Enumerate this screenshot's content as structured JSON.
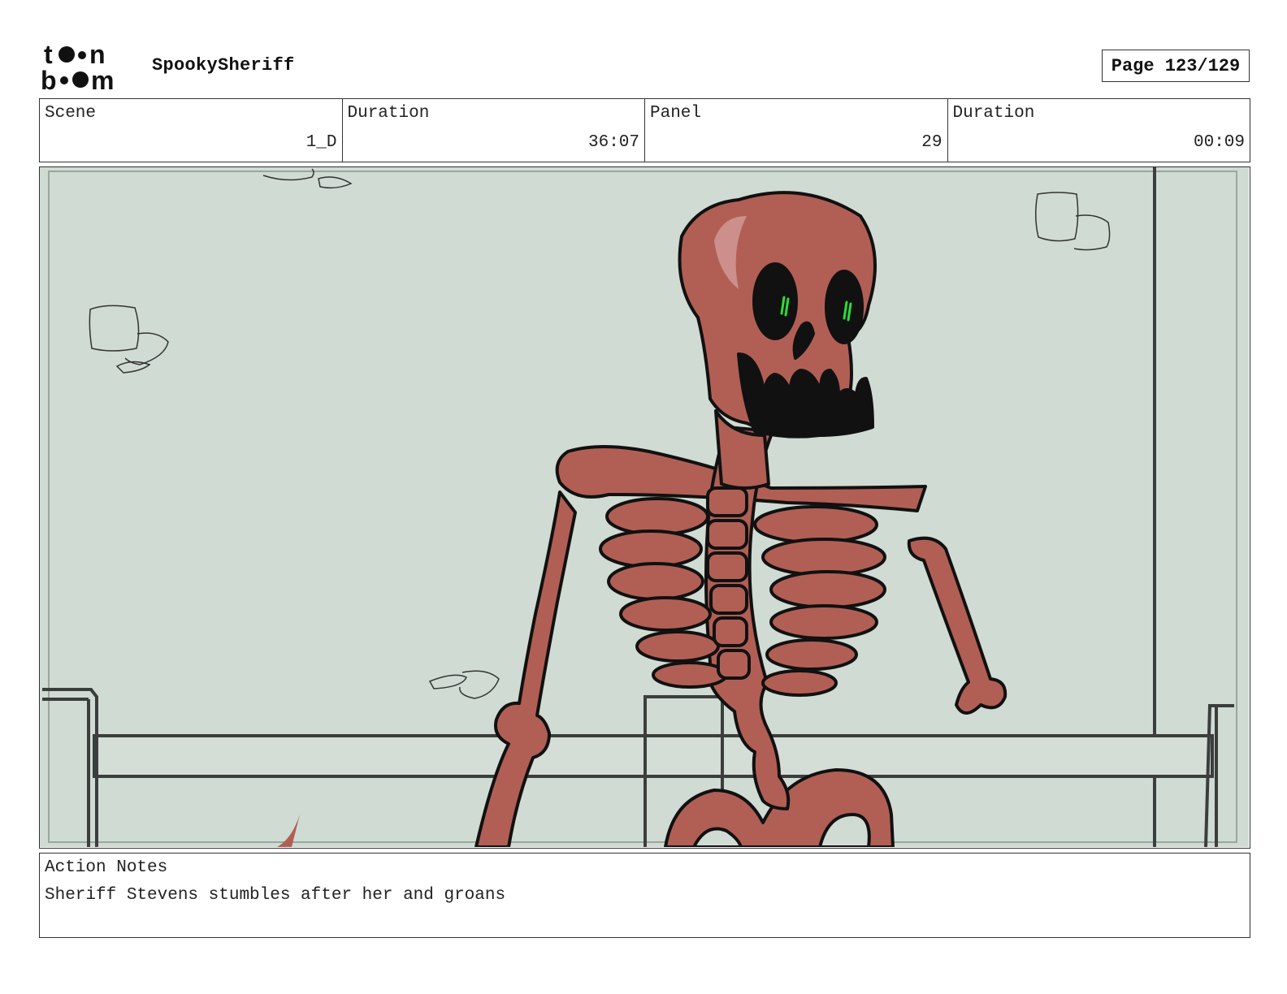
{
  "header": {
    "logo_icon": "toon-boom-logo-icon",
    "logo_text_top": "toon",
    "logo_text_bottom": "boom",
    "project_title": "SpookySheriff",
    "page_label": "Page 123/129"
  },
  "info": {
    "scene_label": "Scene",
    "scene_value": "1_D",
    "scene_duration_label": "Duration",
    "scene_duration_value": "36:07",
    "panel_label": "Panel",
    "panel_value": "29",
    "panel_duration_label": "Duration",
    "panel_duration_value": "00:09"
  },
  "panel_image": {
    "subject": "skeleton-illustration",
    "background_color": "#d0dbd3",
    "bone_color": "#b15f55",
    "bone_highlight_color": "#cd8f8b",
    "eye_color": "#2ddc3a"
  },
  "notes": {
    "label": "Action Notes",
    "text": "Sheriff Stevens stumbles after her and groans"
  }
}
